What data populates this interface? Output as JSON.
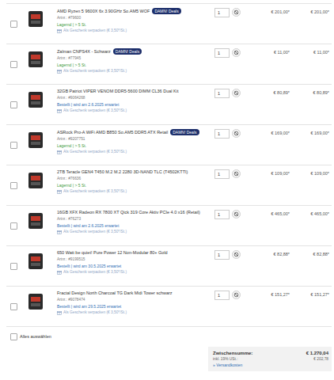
{
  "cart": {
    "items": [
      {
        "title": "AMD Ryzen 5 9600X 6x 3.90GHz So.AM5 WOF",
        "badge": "DAMN! Deals",
        "artnr": "Artnr.: #79600",
        "status": "Lagernd | > 5 St.",
        "status_color": "#3a9a3a",
        "gift": "Als Geschenk verpacken (€ 3,50*/St.)",
        "quantity": "1",
        "price": "€ 201,00*",
        "total": "€ 201,00*",
        "checked": false
      },
      {
        "title": "Zalman CNPS4X - Schwarz",
        "badge": "DAMN! Deals",
        "artnr": "Artnr.: #77945",
        "status": "Lagernd | > 5 St.",
        "status_color": "#3a9a3a",
        "gift": "Als Geschenk verpacken (€ 3,50*/St.)",
        "quantity": "1",
        "price": "€ 11,00*",
        "total": "€ 11,00*",
        "checked": false
      },
      {
        "title": "32GB Patriot VIPER VENOM DDR5-5600 DIMM CL36 Dual Kit",
        "artnr": "Artnr.: #9064268",
        "status": "Bestellt | wird am 2.6.2025 erwartet",
        "status_color": "#2f6fb5",
        "gift": "Als Geschenk verpacken (€ 3,50*/St.)",
        "quantity": "1",
        "price": "€ 80,89*",
        "total": "€ 80,89*",
        "checked": false
      },
      {
        "title": "ASRock Pro-A WiFi AMD B850 So.AM5 DDR5 ATX Retail",
        "badge": "DAMN! Deals",
        "artnr": "Artnr.: #9207751",
        "status": "Lagernd | > 5 St.",
        "status_color": "#3a9a3a",
        "gift": "Als Geschenk verpacken (€ 3,50*/St.)",
        "quantity": "1",
        "price": "€ 169,00*",
        "total": "€ 169,00*",
        "checked": false
      },
      {
        "title": "2TB Teracle GEN4 T450 M.2 M.2 2280 3D-NAND TLC (T4502KTTI)",
        "artnr": "Artnr.: #76636",
        "status": "Lagernd | > 5 St.",
        "status_color": "#3a9a3a",
        "gift": "Als Geschenk verpacken (€ 3,50*/St.)",
        "quantity": "1",
        "price": "€ 109,00*",
        "total": "€ 109,00*",
        "checked": false
      },
      {
        "title": "16GB XFX Radeon RX 7800 XT Qick 319 Core Aktiv PCIe 4.0 x16 (Retail)",
        "artnr": "Artnr.: #76273",
        "status": "Bestellt | wird am 2.6.2025 erwartet",
        "status_color": "#2f6fb5",
        "gift": "Als Geschenk verpacken (€ 3,50*/St.)",
        "quantity": "1",
        "price": "€ 465,00*",
        "total": "€ 465,00*",
        "checked": false
      },
      {
        "title": "650 Watt be quiet! Pure Power 12 Non-Modular 80+ Gold",
        "artnr": "Artnr.: #9199515",
        "status": "Bestellt | wird am 30.5.2025 erwartet",
        "status_color": "#2f6fb5",
        "gift": "Als Geschenk verpacken (€ 3,50*/St.)",
        "quantity": "1",
        "price": "€ 82,88*",
        "total": "€ 82,88*",
        "checked": false
      },
      {
        "title": "Fractal Design North Charcoal TG Dark Midi Tower schwarz",
        "artnr": "Artnr.: #9078474",
        "status": "Bestellt | wird am 29.5.2025 erwartet",
        "status_color": "#2f6fb5",
        "gift": "Als Geschenk verpacken (€ 3,50*/St.)",
        "quantity": "1",
        "price": "€ 151,27*",
        "total": "€ 151,27*",
        "checked": false
      }
    ],
    "select_all": {
      "label": "Alles auswählen",
      "checked": false
    },
    "summary": {
      "subtotal_label": "Zwischensumme:",
      "subtotal": "€ 1.270,04",
      "tax_label": "inkl. 19% USt.:",
      "tax": "€ 202,78",
      "shipping_link": "» Versandkosten"
    }
  }
}
